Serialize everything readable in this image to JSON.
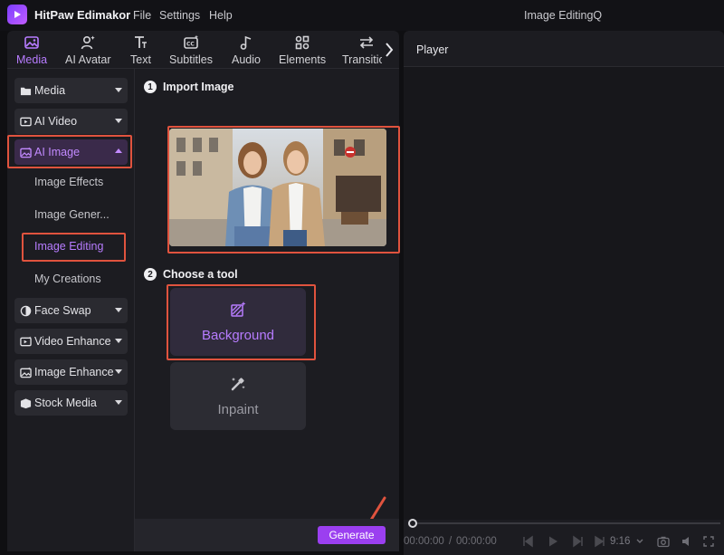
{
  "app": {
    "name": "HitPaw Edimakor",
    "window_title": "Image EditingQ"
  },
  "menu": [
    "File",
    "Settings",
    "Help"
  ],
  "tabs": [
    {
      "label": "Media",
      "icon": "image-icon",
      "active": true
    },
    {
      "label": "AI Avatar",
      "icon": "avatar-icon"
    },
    {
      "label": "Text",
      "icon": "text-icon"
    },
    {
      "label": "Subtitles",
      "icon": "subtitles-icon"
    },
    {
      "label": "Audio",
      "icon": "music-note-icon"
    },
    {
      "label": "Elements",
      "icon": "elements-icon"
    },
    {
      "label": "Transitio",
      "icon": "transition-icon"
    }
  ],
  "sidebar": {
    "categories": [
      {
        "label": "Media",
        "icon": "folder-icon"
      },
      {
        "label": "AI Video",
        "icon": "video-icon"
      },
      {
        "label": "AI Image",
        "icon": "ai-image-icon",
        "open": true
      },
      {
        "label": "Face Swap",
        "icon": "face-swap-icon"
      },
      {
        "label": "Video Enhance",
        "icon": "video-enhance-icon"
      },
      {
        "label": "Image Enhance",
        "icon": "image-enhance-icon"
      },
      {
        "label": "Stock Media",
        "icon": "stock-media-icon"
      }
    ],
    "ai_image_items": [
      "Image Effects",
      "Image Gener...",
      "Image Editing",
      "My Creations"
    ]
  },
  "content": {
    "step1": {
      "num": "1",
      "label": "Import Image"
    },
    "step2": {
      "num": "2",
      "label": "Choose a tool"
    },
    "tools": [
      {
        "label": "Background",
        "icon": "background-tool-icon",
        "active": true
      },
      {
        "label": "Inpaint",
        "icon": "inpaint-tool-icon"
      }
    ],
    "generate_label": "Generate"
  },
  "player": {
    "title": "Player",
    "current_time": "00:00:00",
    "separator": "/",
    "total_time": "00:00:00",
    "aspect": "9:16"
  },
  "colors": {
    "accent": "#b77cff",
    "highlight": "#e0533e",
    "generate": "#9b3ff0"
  }
}
